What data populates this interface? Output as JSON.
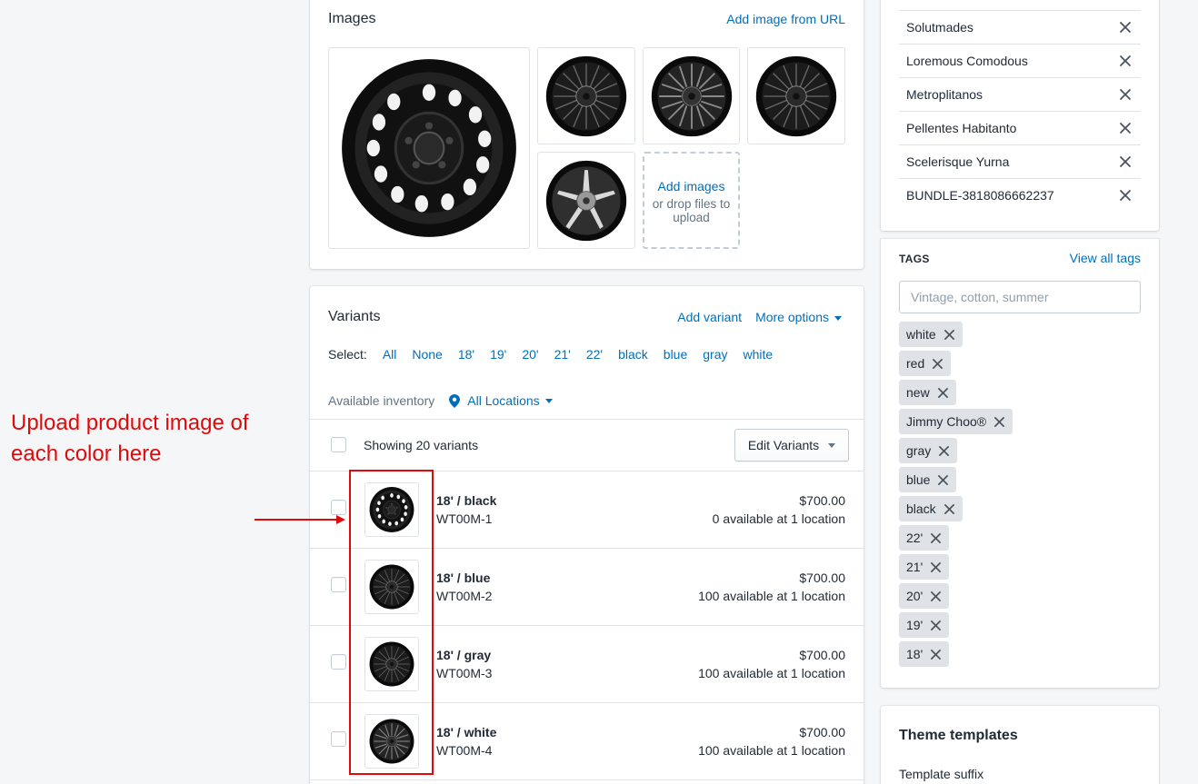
{
  "images": {
    "title": "Images",
    "add_from_url": "Add image from URL",
    "dropzone": {
      "title": "Add images",
      "subtitle": "or drop files to upload"
    }
  },
  "variants": {
    "title": "Variants",
    "add_variant": "Add variant",
    "more_options": "More options",
    "select_label": "Select:",
    "select_options": [
      "All",
      "None",
      "18'",
      "19'",
      "20'",
      "21'",
      "22'",
      "black",
      "blue",
      "gray",
      "white"
    ],
    "inventory_label": "Available inventory",
    "locations": "All Locations",
    "showing": "Showing 20 variants",
    "edit_button": "Edit Variants",
    "rows": [
      {
        "name": "18' / black",
        "sku": "WT00M-1",
        "price": "$700.00",
        "availability": "0 available at 1 location"
      },
      {
        "name": "18' / blue",
        "sku": "WT00M-2",
        "price": "$700.00",
        "availability": "100 available at 1 location"
      },
      {
        "name": "18' / gray",
        "sku": "WT00M-3",
        "price": "$700.00",
        "availability": "100 available at 1 location"
      },
      {
        "name": "18' / white",
        "sku": "WT00M-4",
        "price": "$700.00",
        "availability": "100 available at 1 location"
      }
    ]
  },
  "annotation": {
    "line1": "Upload product image of",
    "line2": "each color here",
    "color": "#e00a0a"
  },
  "collections": {
    "items": [
      "Solutmades",
      "Loremous Comodous",
      "Metroplitanos",
      "Pellentes Habitanto",
      "Scelerisque Yurna",
      "BUNDLE-3818086662237"
    ]
  },
  "tags": {
    "heading": "TAGS",
    "view_all": "View all tags",
    "placeholder": "Vintage, cotton, summer",
    "items": [
      "white",
      "red",
      "new",
      "Jimmy Choo®",
      "gray",
      "blue",
      "black",
      "22'",
      "21'",
      "20'",
      "19'",
      "18'"
    ]
  },
  "theme": {
    "title": "Theme templates",
    "suffix_label": "Template suffix"
  },
  "colors": {
    "link": "#006fbb",
    "background": "#f4f6f8",
    "tag_bg": "#dfe3e8",
    "annotation_red": "#e00a0a"
  }
}
